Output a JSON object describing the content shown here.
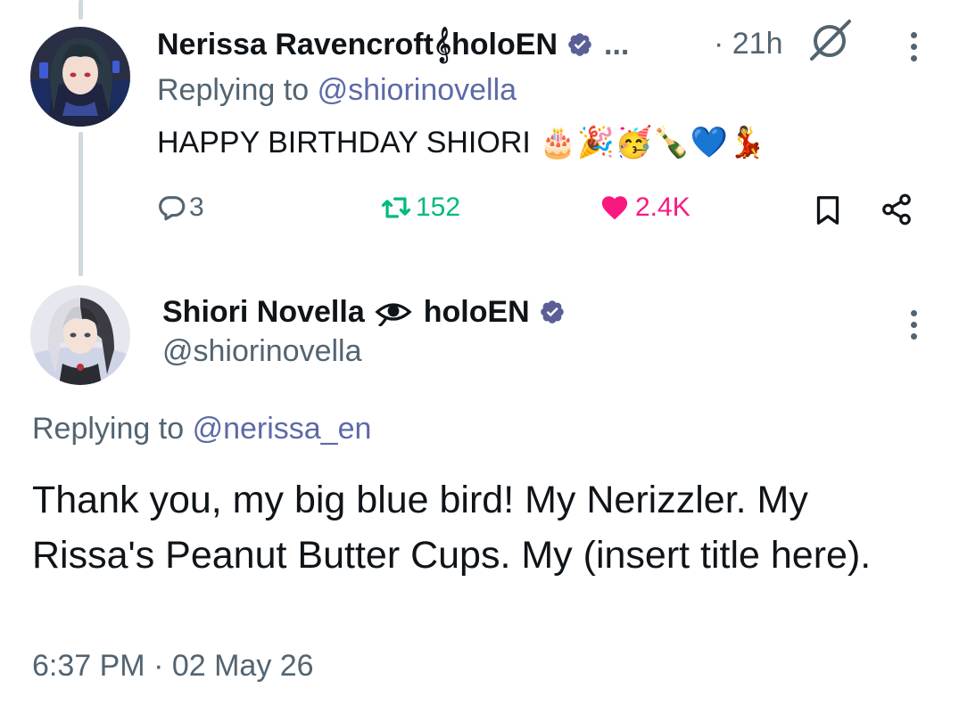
{
  "parent_tweet": {
    "display_name": "Nerissa Ravencroft𝄞holoEN",
    "ellipsis": "...",
    "time_ago": "· 21h",
    "replying_prefix": "Replying to",
    "replying_handle": "@shiorinovella",
    "text": "HAPPY BIRTHDAY SHIORI 🎂🎉🥳🍾💙💃",
    "stats": {
      "replies": "3",
      "retweets": "152",
      "likes": "2.4K"
    }
  },
  "main_tweet": {
    "display_name": "Shiori Novella",
    "name_suffix": "holoEN",
    "handle": "@shiorinovella",
    "replying_prefix": "Replying to",
    "replying_handle": "@nerissa_en",
    "text": "Thank you, my big blue bird! My Nerizzler. My Rissa's Peanut Butter Cups. My (insert title here).",
    "timestamp": "6:37 PM · 02 May 26"
  },
  "colors": {
    "verified": "#5b5f97",
    "retweet": "#00ba7c",
    "like": "#f91880",
    "muted": "#536471",
    "link": "#5d6aa8",
    "thread_line": "#cfd9de"
  },
  "icons": [
    "verified-badge-icon",
    "grok-icon",
    "more-icon",
    "reply-icon",
    "retweet-icon",
    "like-icon",
    "bookmark-icon",
    "share-icon",
    "eye-icon"
  ]
}
